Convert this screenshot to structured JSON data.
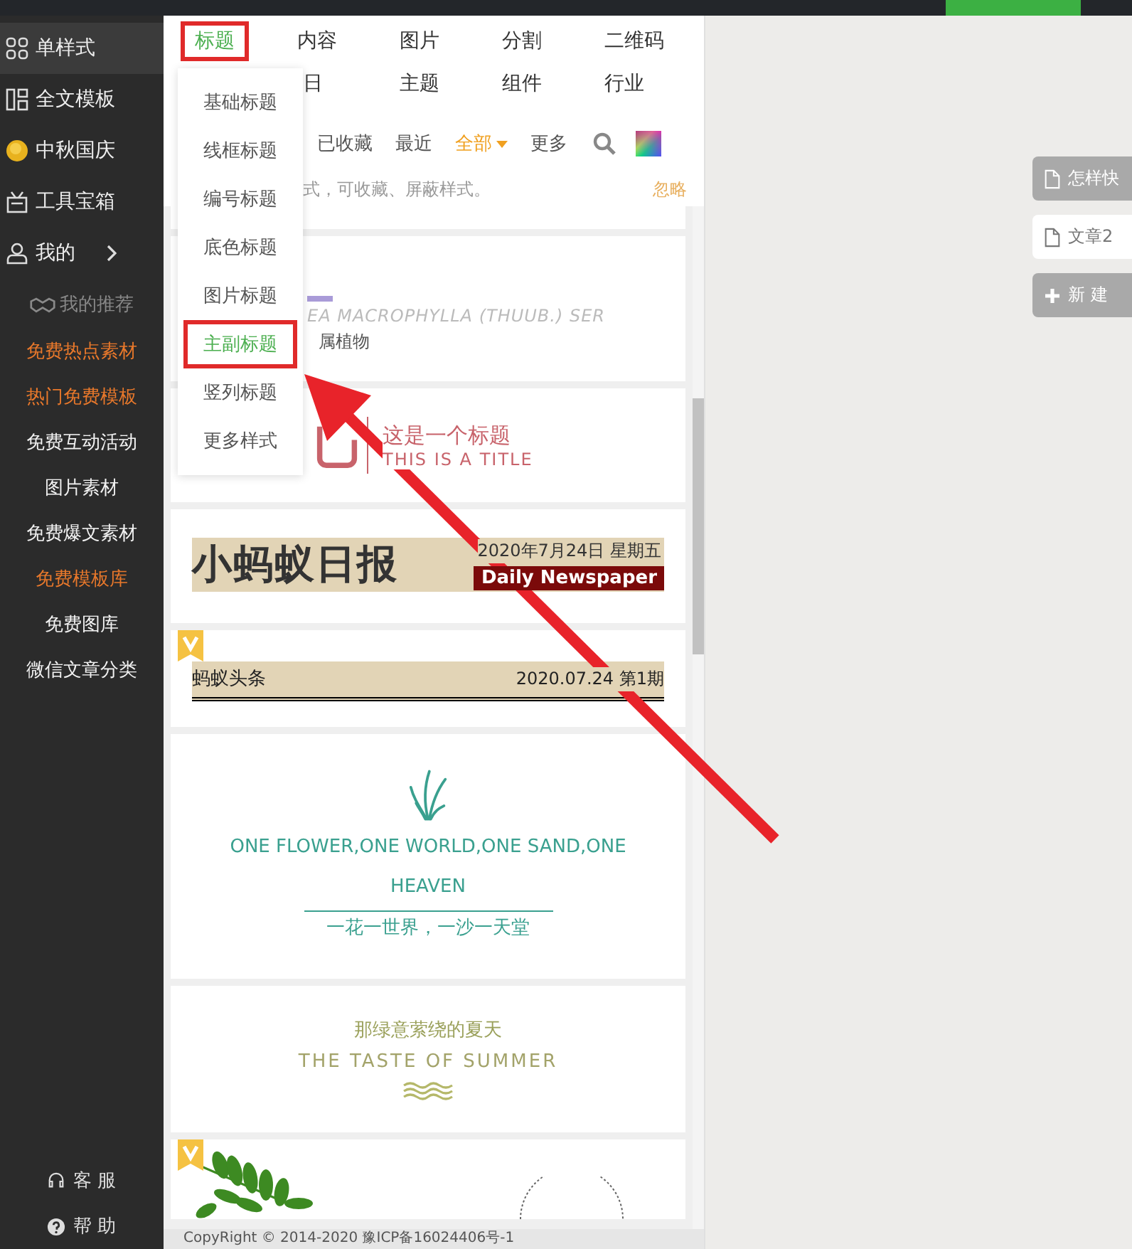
{
  "sidebar": {
    "items": [
      {
        "label": "单样式",
        "selected": true,
        "submenu": false
      },
      {
        "label": "全文模板",
        "selected": false,
        "submenu": false
      },
      {
        "label": "中秋国庆",
        "selected": false,
        "submenu": false
      },
      {
        "label": "工具宝箱",
        "selected": false,
        "submenu": false
      },
      {
        "label": "我的",
        "selected": false,
        "submenu": true
      }
    ],
    "recommend_heading": "我的推荐",
    "links": [
      {
        "label": "免费热点素材",
        "highlighted": true
      },
      {
        "label": "热门免费模板",
        "highlighted": true
      },
      {
        "label": "免费互动活动",
        "highlighted": false
      },
      {
        "label": "图片素材",
        "highlighted": false
      },
      {
        "label": "免费爆文素材",
        "highlighted": false
      },
      {
        "label": "免费模板库",
        "highlighted": true
      },
      {
        "label": "免费图库",
        "highlighted": false
      },
      {
        "label": "微信文章分类",
        "highlighted": false
      }
    ],
    "footer": [
      "客 服",
      "帮 助"
    ]
  },
  "panel": {
    "tabs": [
      {
        "label": "标题",
        "selected": true
      },
      {
        "label": "内容",
        "selected": false
      },
      {
        "label": "图片",
        "selected": false
      },
      {
        "label": "分割",
        "selected": false
      },
      {
        "label": "二维码",
        "selected": false
      },
      {
        "label": "日",
        "selected": false
      },
      {
        "label": "主题",
        "selected": false
      },
      {
        "label": "组件",
        "selected": false
      },
      {
        "label": "行业",
        "selected": false
      }
    ],
    "filters": [
      {
        "label": "已收藏",
        "selected": false,
        "dropdown": false
      },
      {
        "label": "最近",
        "selected": false,
        "dropdown": false
      },
      {
        "label": "全部",
        "selected": true,
        "dropdown": true
      },
      {
        "label": "更多",
        "selected": false,
        "dropdown": false
      }
    ],
    "notice": "式，可收藏、屏蔽样式。",
    "dismiss": "忽略",
    "dropdown": {
      "items": [
        {
          "label": "基础标题",
          "selected": false
        },
        {
          "label": "线框标题",
          "selected": false
        },
        {
          "label": "编号标题",
          "selected": false
        },
        {
          "label": "底色标题",
          "selected": false
        },
        {
          "label": "图片标题",
          "selected": false
        },
        {
          "label": "主副标题",
          "selected": true
        },
        {
          "label": "竖列标题",
          "selected": false
        },
        {
          "label": "更多样式",
          "selected": false
        }
      ]
    },
    "cards": [
      {
        "kind": "plant",
        "latin": "EA MACROPHYLLA (THUUB.) SER",
        "chinese": "属植物"
      },
      {
        "kind": "icon-title",
        "title": "这是一个标题",
        "subtitle": "THIS IS A TITLE"
      },
      {
        "kind": "newspaper",
        "vip": false,
        "name": "小蚂蚁日报",
        "date": "2020年7月24日 星期五",
        "english": "Daily Newspaper"
      },
      {
        "kind": "headline",
        "vip": true,
        "name": "蚂蚁头条",
        "issue": "2020.07.24 第1期"
      },
      {
        "kind": "quote",
        "vip": false,
        "english": "ONE FLOWER,ONE WORLD,ONE SAND,ONE HEAVEN",
        "chinese": "一花一世界，一沙一天堂"
      },
      {
        "kind": "summer",
        "vip": false,
        "chinese": "那绿意萦绕的夏天",
        "english": "THE TASTE OF SUMMER"
      },
      {
        "kind": "leaves",
        "vip": true
      }
    ],
    "copyright": "CopyRight © 2014-2020 豫ICP备16024406号-1"
  },
  "documents": [
    {
      "kind": "doc",
      "label": "怎样快",
      "selected": false
    },
    {
      "kind": "doc",
      "label": "文章2",
      "selected": true
    },
    {
      "kind": "new",
      "label": "新 建",
      "selected": false
    }
  ]
}
